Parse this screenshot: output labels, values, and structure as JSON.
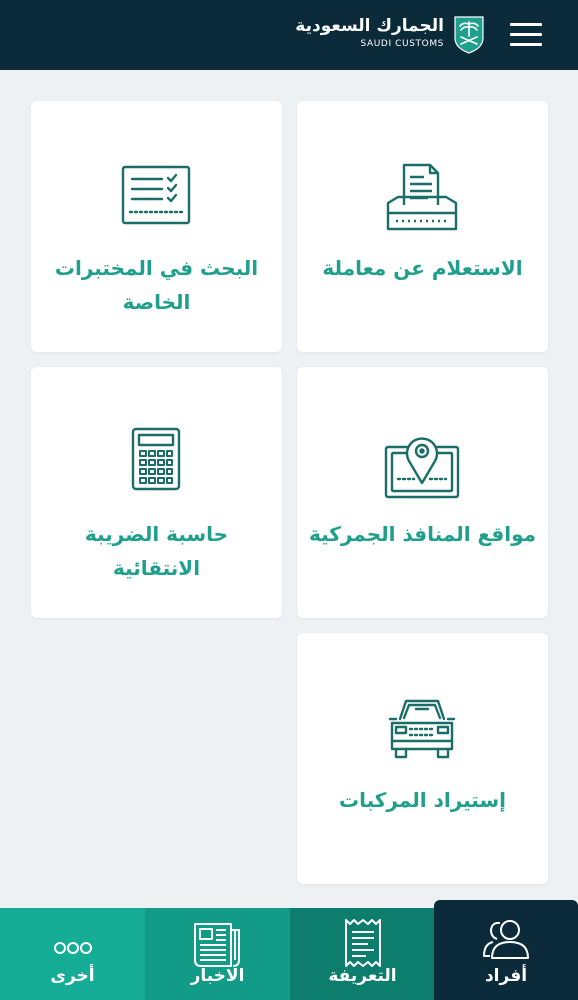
{
  "header": {
    "title_ar": "الجمارك السعودية",
    "title_en": "SAUDI CUSTOMS",
    "logo_icon": "palm-swords-emblem",
    "menu_icon": "hamburger-menu-icon"
  },
  "colors": {
    "header_bg": "#0b2a3a",
    "accent": "#1ea08c",
    "page_bg": "#eef1f4",
    "nav_other": "#16ad97",
    "nav_news": "#129b86",
    "nav_tariff": "#0d7d6d",
    "nav_individuals_active": "#0b2a3a"
  },
  "cards": [
    {
      "id": "transaction-inquiry",
      "label": "الاستعلام عن معاملة",
      "icon": "inbox-document-icon"
    },
    {
      "id": "lab-search",
      "label": "البحث في المختبرات الخاصة",
      "icon": "checklist-icon"
    },
    {
      "id": "customs-ports",
      "label": "مواقع المنافذ الجمركية",
      "icon": "map-pin-icon"
    },
    {
      "id": "transitional-tax",
      "label": "حاسبة الضريبة الانتقائية",
      "icon": "calculator-icon"
    },
    {
      "id": "vehicle-import",
      "label": "إستيراد المركبات",
      "icon": "car-icon"
    }
  ],
  "bottom_nav": [
    {
      "id": "individuals",
      "label": "أفراد",
      "icon": "people-icon",
      "active": true
    },
    {
      "id": "tariff",
      "label": "التعريفة",
      "icon": "receipt-icon",
      "active": false
    },
    {
      "id": "news",
      "label": "الاخبار",
      "icon": "newspaper-icon",
      "active": false
    },
    {
      "id": "other",
      "label": "أخرى",
      "icon": "more-dots-icon",
      "active": false
    }
  ]
}
